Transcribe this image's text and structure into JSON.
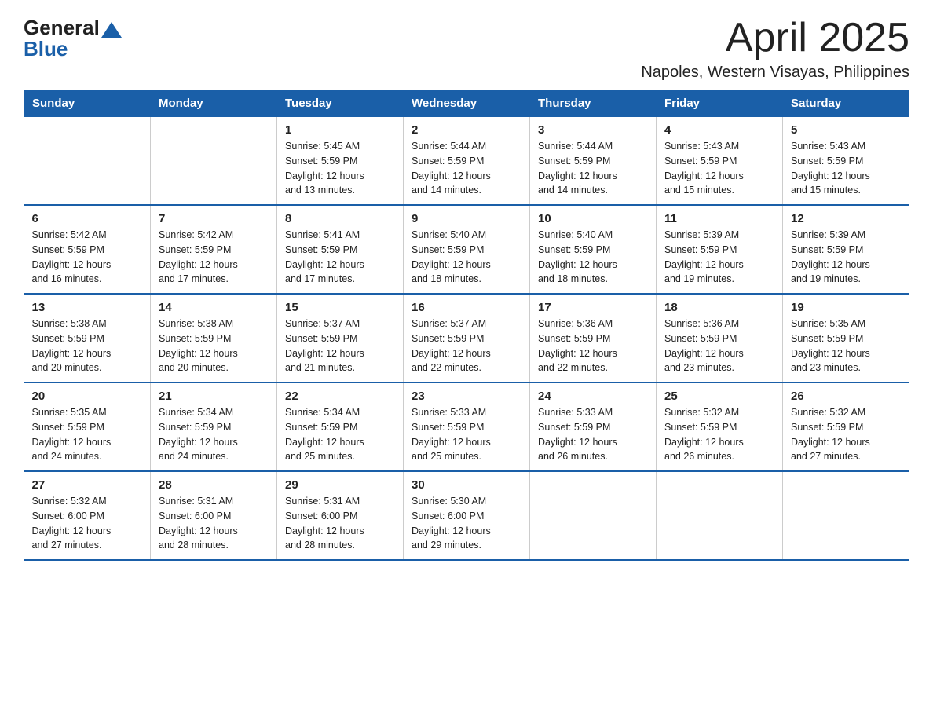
{
  "logo": {
    "general": "General",
    "blue": "Blue"
  },
  "title": "April 2025",
  "subtitle": "Napoles, Western Visayas, Philippines",
  "calendar": {
    "headers": [
      "Sunday",
      "Monday",
      "Tuesday",
      "Wednesday",
      "Thursday",
      "Friday",
      "Saturday"
    ],
    "weeks": [
      [
        {
          "day": "",
          "info": ""
        },
        {
          "day": "",
          "info": ""
        },
        {
          "day": "1",
          "info": "Sunrise: 5:45 AM\nSunset: 5:59 PM\nDaylight: 12 hours\nand 13 minutes."
        },
        {
          "day": "2",
          "info": "Sunrise: 5:44 AM\nSunset: 5:59 PM\nDaylight: 12 hours\nand 14 minutes."
        },
        {
          "day": "3",
          "info": "Sunrise: 5:44 AM\nSunset: 5:59 PM\nDaylight: 12 hours\nand 14 minutes."
        },
        {
          "day": "4",
          "info": "Sunrise: 5:43 AM\nSunset: 5:59 PM\nDaylight: 12 hours\nand 15 minutes."
        },
        {
          "day": "5",
          "info": "Sunrise: 5:43 AM\nSunset: 5:59 PM\nDaylight: 12 hours\nand 15 minutes."
        }
      ],
      [
        {
          "day": "6",
          "info": "Sunrise: 5:42 AM\nSunset: 5:59 PM\nDaylight: 12 hours\nand 16 minutes."
        },
        {
          "day": "7",
          "info": "Sunrise: 5:42 AM\nSunset: 5:59 PM\nDaylight: 12 hours\nand 17 minutes."
        },
        {
          "day": "8",
          "info": "Sunrise: 5:41 AM\nSunset: 5:59 PM\nDaylight: 12 hours\nand 17 minutes."
        },
        {
          "day": "9",
          "info": "Sunrise: 5:40 AM\nSunset: 5:59 PM\nDaylight: 12 hours\nand 18 minutes."
        },
        {
          "day": "10",
          "info": "Sunrise: 5:40 AM\nSunset: 5:59 PM\nDaylight: 12 hours\nand 18 minutes."
        },
        {
          "day": "11",
          "info": "Sunrise: 5:39 AM\nSunset: 5:59 PM\nDaylight: 12 hours\nand 19 minutes."
        },
        {
          "day": "12",
          "info": "Sunrise: 5:39 AM\nSunset: 5:59 PM\nDaylight: 12 hours\nand 19 minutes."
        }
      ],
      [
        {
          "day": "13",
          "info": "Sunrise: 5:38 AM\nSunset: 5:59 PM\nDaylight: 12 hours\nand 20 minutes."
        },
        {
          "day": "14",
          "info": "Sunrise: 5:38 AM\nSunset: 5:59 PM\nDaylight: 12 hours\nand 20 minutes."
        },
        {
          "day": "15",
          "info": "Sunrise: 5:37 AM\nSunset: 5:59 PM\nDaylight: 12 hours\nand 21 minutes."
        },
        {
          "day": "16",
          "info": "Sunrise: 5:37 AM\nSunset: 5:59 PM\nDaylight: 12 hours\nand 22 minutes."
        },
        {
          "day": "17",
          "info": "Sunrise: 5:36 AM\nSunset: 5:59 PM\nDaylight: 12 hours\nand 22 minutes."
        },
        {
          "day": "18",
          "info": "Sunrise: 5:36 AM\nSunset: 5:59 PM\nDaylight: 12 hours\nand 23 minutes."
        },
        {
          "day": "19",
          "info": "Sunrise: 5:35 AM\nSunset: 5:59 PM\nDaylight: 12 hours\nand 23 minutes."
        }
      ],
      [
        {
          "day": "20",
          "info": "Sunrise: 5:35 AM\nSunset: 5:59 PM\nDaylight: 12 hours\nand 24 minutes."
        },
        {
          "day": "21",
          "info": "Sunrise: 5:34 AM\nSunset: 5:59 PM\nDaylight: 12 hours\nand 24 minutes."
        },
        {
          "day": "22",
          "info": "Sunrise: 5:34 AM\nSunset: 5:59 PM\nDaylight: 12 hours\nand 25 minutes."
        },
        {
          "day": "23",
          "info": "Sunrise: 5:33 AM\nSunset: 5:59 PM\nDaylight: 12 hours\nand 25 minutes."
        },
        {
          "day": "24",
          "info": "Sunrise: 5:33 AM\nSunset: 5:59 PM\nDaylight: 12 hours\nand 26 minutes."
        },
        {
          "day": "25",
          "info": "Sunrise: 5:32 AM\nSunset: 5:59 PM\nDaylight: 12 hours\nand 26 minutes."
        },
        {
          "day": "26",
          "info": "Sunrise: 5:32 AM\nSunset: 5:59 PM\nDaylight: 12 hours\nand 27 minutes."
        }
      ],
      [
        {
          "day": "27",
          "info": "Sunrise: 5:32 AM\nSunset: 6:00 PM\nDaylight: 12 hours\nand 27 minutes."
        },
        {
          "day": "28",
          "info": "Sunrise: 5:31 AM\nSunset: 6:00 PM\nDaylight: 12 hours\nand 28 minutes."
        },
        {
          "day": "29",
          "info": "Sunrise: 5:31 AM\nSunset: 6:00 PM\nDaylight: 12 hours\nand 28 minutes."
        },
        {
          "day": "30",
          "info": "Sunrise: 5:30 AM\nSunset: 6:00 PM\nDaylight: 12 hours\nand 29 minutes."
        },
        {
          "day": "",
          "info": ""
        },
        {
          "day": "",
          "info": ""
        },
        {
          "day": "",
          "info": ""
        }
      ]
    ]
  }
}
